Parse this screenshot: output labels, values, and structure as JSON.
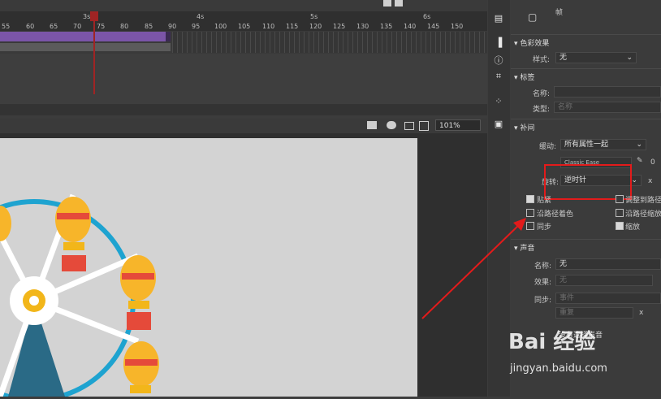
{
  "timeline": {
    "seconds": [
      "3s",
      "4s",
      "5s",
      "6s"
    ],
    "frames": [
      "55",
      "60",
      "65",
      "70",
      "75",
      "80",
      "85",
      "90",
      "95",
      "100",
      "105",
      "110",
      "115",
      "120",
      "125",
      "130",
      "135",
      "140",
      "145",
      "150"
    ]
  },
  "stage": {
    "zoom": "101%"
  },
  "properties": {
    "frame_label": "帧",
    "color_effect": {
      "header": "色彩效果",
      "style_label": "样式:",
      "style_value": "无"
    },
    "label": {
      "header": "标签",
      "name_label": "名称:",
      "type_label": "类型:",
      "type_value": "名称"
    },
    "tween": {
      "header": "补间",
      "ease_label": "缓动:",
      "ease_value": "所有属性一起",
      "preset": "Classic Ease",
      "ease_num": "0",
      "rotate_label": "旋转:",
      "rotate_value": "逆时针",
      "rotate_count": "x",
      "snap": "贴紧",
      "orient_path": "调整到路径",
      "path_color": "沿路径着色",
      "path_scale": "沿路径缩放",
      "sync": "同步",
      "scale": "缩放"
    },
    "sound": {
      "header": "声音",
      "name_label": "名称:",
      "name_value": "无",
      "effect_label": "效果:",
      "effect_value": "无",
      "sync_label": "同步:",
      "sync_value": "事件",
      "repeat_value": "重复",
      "repeat_x": "x",
      "no_sound": "没有选择声音"
    }
  },
  "watermark": {
    "brand": "Bai 经验",
    "url": "jingyan.baidu.com"
  },
  "colors": {
    "annotation": "#e31b1b",
    "tween_span": "#7b55a8",
    "wheel": "#1ea3d0"
  }
}
